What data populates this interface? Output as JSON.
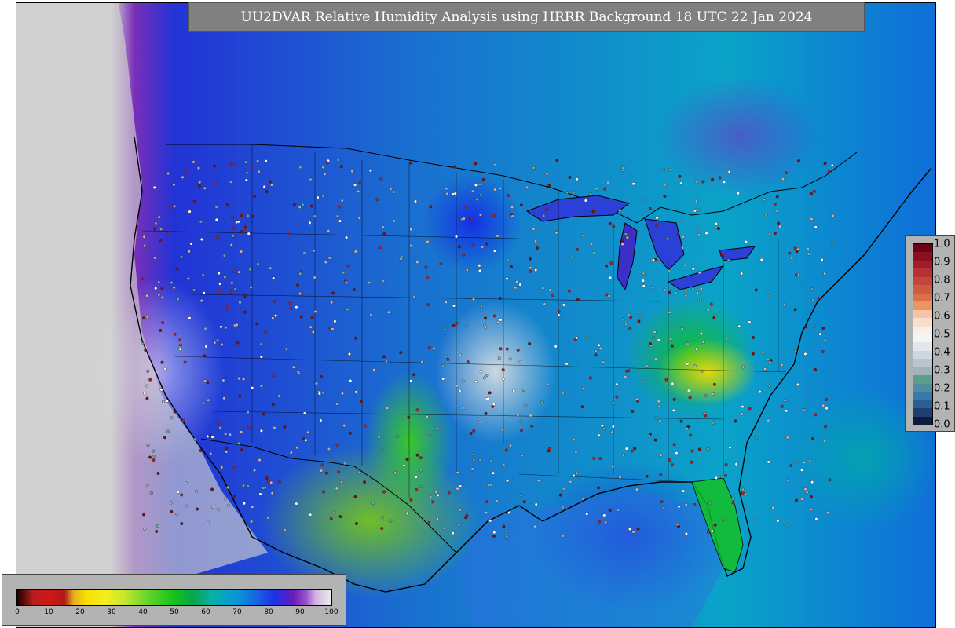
{
  "title": "UU2DVAR Relative Humidity Analysis using HRRR Background 18 UTC 22 Jan 2024",
  "colorbar_vertical": {
    "ticks": [
      "0.0",
      "0.1",
      "0.2",
      "0.3",
      "0.4",
      "0.5",
      "0.6",
      "0.7",
      "0.8",
      "0.9",
      "1.0"
    ],
    "colors": [
      "#0d1b3d",
      "#1f3f6e",
      "#2a5f93",
      "#3a7aab",
      "#4f8e9c",
      "#5c9e8c",
      "#9fb3bf",
      "#b9c6cf",
      "#cfd7de",
      "#e3e6ea",
      "#f4f4f4",
      "#f7f0ea",
      "#f6dfcc",
      "#f3c4a6",
      "#e8955f",
      "#d97048",
      "#cf5a44",
      "#c2473a",
      "#b53232",
      "#a01e2a",
      "#8b0f20",
      "#700015"
    ]
  },
  "colorbar_horizontal": {
    "ticks": [
      "0",
      "10",
      "20",
      "30",
      "40",
      "50",
      "60",
      "70",
      "80",
      "90",
      "100"
    ]
  }
}
